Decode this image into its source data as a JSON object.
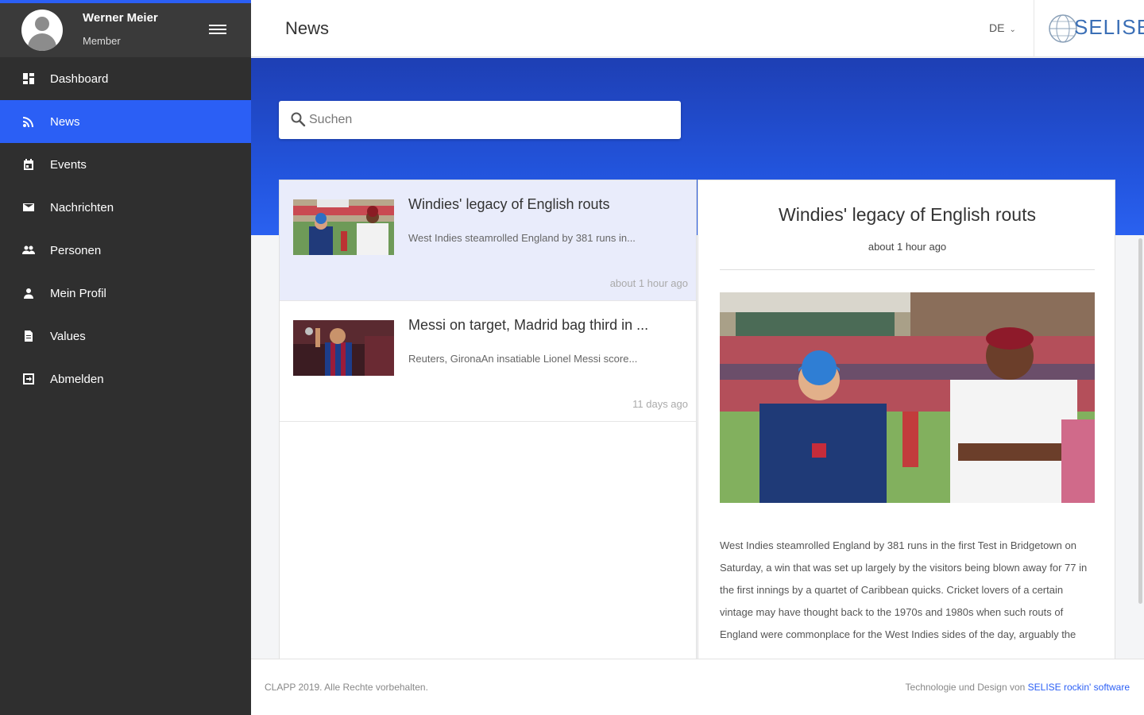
{
  "user": {
    "name": "Werner Meier",
    "role": "Member"
  },
  "sidebar": {
    "items": [
      {
        "label": "Dashboard",
        "icon": "dashboard-icon"
      },
      {
        "label": "News",
        "icon": "rss-icon",
        "active": true
      },
      {
        "label": "Events",
        "icon": "calendar-icon"
      },
      {
        "label": "Nachrichten",
        "icon": "mail-icon"
      },
      {
        "label": "Personen",
        "icon": "people-icon"
      },
      {
        "label": "Mein Profil",
        "icon": "person-icon"
      },
      {
        "label": "Values",
        "icon": "document-icon"
      },
      {
        "label": "Abmelden",
        "icon": "logout-icon"
      }
    ]
  },
  "header": {
    "title": "News",
    "language": "DE",
    "logo_text": "SELISE"
  },
  "search": {
    "placeholder": "Suchen"
  },
  "news": [
    {
      "title": "Windies' legacy of English routs",
      "excerpt": "West Indies steamrolled England by 381 runs in...",
      "time": "about 1 hour ago",
      "selected": true
    },
    {
      "title": "Messi on target, Madrid bag third in ...",
      "excerpt": "Reuters, GironaAn insatiable Lionel Messi score...",
      "time": "11 days ago",
      "selected": false
    }
  ],
  "detail": {
    "title": "Windies' legacy of English routs",
    "time": "about 1 hour ago",
    "body": "West Indies steamrolled England by 381 runs in the first Test in Bridgetown on Saturday, a win that was set up largely by the visitors being blown away for 77 in the first innings by a quartet of Caribbean quicks. Cricket lovers of a certain vintage may have thought back to the 1970s and 1980s when such routs of England were commonplace for the West Indies sides of the day, arguably the"
  },
  "footer": {
    "copyright": "CLAPP 2019. Alle Rechte vorbehalten.",
    "credit_prefix": "Technologie und Design von",
    "credit_link": "SELISE rockin' software"
  }
}
